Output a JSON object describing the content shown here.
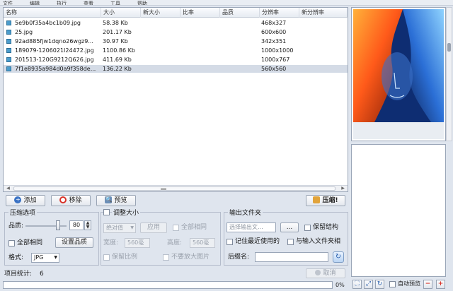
{
  "menu": [
    "文件",
    "编辑",
    "执行",
    "查看",
    "工具",
    "帮助"
  ],
  "file_list": {
    "columns": [
      "名称",
      "大小",
      "新大小",
      "比率",
      "品质",
      "分辨率",
      "新分辨率"
    ],
    "rows": [
      {
        "name": "5e9b0f35a4bc1b09.jpg",
        "size": "58.38 Kb",
        "resolution": "468x327",
        "selected": false
      },
      {
        "name": "25.jpg",
        "size": "201.17 Kb",
        "resolution": "600x600",
        "selected": false
      },
      {
        "name": "92ad885fjw1dqno26wgz9...",
        "size": "30.97 Kb",
        "resolution": "342x351",
        "selected": false
      },
      {
        "name": "189079-1206021I24472.jpg",
        "size": "1100.86 Kb",
        "resolution": "1000x1000",
        "selected": false
      },
      {
        "name": "201513-120G9212Q626.jpg",
        "size": "411.69 Kb",
        "resolution": "1000x767",
        "selected": false
      },
      {
        "name": "7f1e8935a984d0a9f358de...",
        "size": "136.22 Kb",
        "resolution": "560x560",
        "selected": true
      }
    ]
  },
  "toolbar": {
    "add_label": "添加",
    "remove_label": "移除",
    "preview_label": "预览",
    "compress_label": "压缩!"
  },
  "compress_options": {
    "title": "压缩选项",
    "quality_label": "品质:",
    "quality_value": "80",
    "quality_level": 0.8,
    "all_same_label": "全部相同",
    "set_quality_label": "设置品质",
    "format_label": "格式:",
    "format_value": "JPG"
  },
  "resize": {
    "title": "调整大小",
    "mode_value": "绝对值",
    "apply_label": "应用",
    "all_same_label": "全部相同",
    "width_label": "宽度:",
    "width_value": "560毫",
    "height_label": "高度:",
    "height_value": "560毫",
    "keep_ratio_label": "保留比例",
    "no_enlarge_label": "不要放大图片"
  },
  "output": {
    "title": "输出文件夹",
    "folder_placeholder": "选择输出文...",
    "browse_label": "...",
    "keep_structure_label": "保留结构",
    "remember_recent_label": "记住最近使用的",
    "same_as_input_label": "与输入文件夹相",
    "suffix_label": "后缀名:"
  },
  "status": {
    "count_label": "项目统计:",
    "count_value": "6",
    "cancel_label": "取消",
    "progress_text": "0%",
    "progress": 0
  },
  "right_panel": {
    "auto_preview_label": "自动预览"
  },
  "colors": {
    "selection": "#d4dbe6",
    "window_bg": "#dfe5ee",
    "red_icon": "#d9342b",
    "blue_icon": "#3a72c4"
  }
}
